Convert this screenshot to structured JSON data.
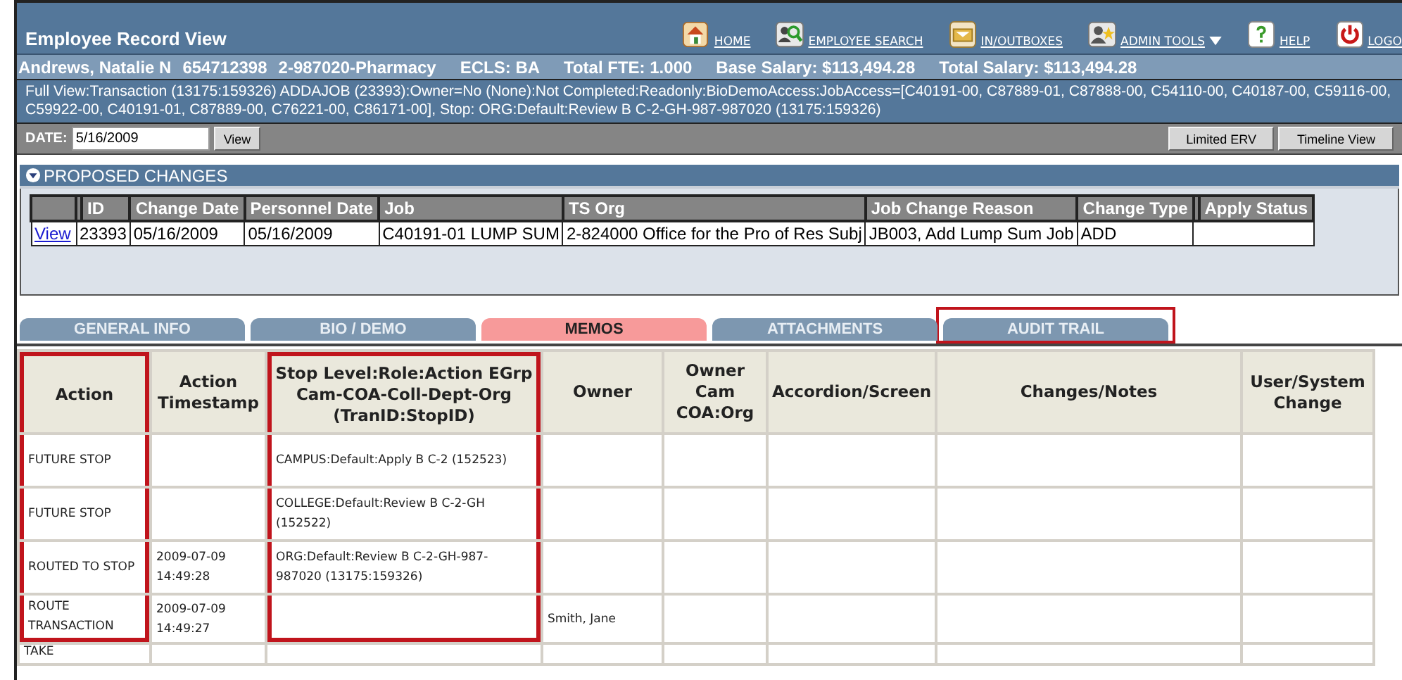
{
  "header": {
    "title": "Employee Record View",
    "nav": [
      {
        "label": "HOME",
        "dropdown": false
      },
      {
        "label": "EMPLOYEE SEARCH",
        "dropdown": false
      },
      {
        "label": "IN/OUTBOXES",
        "dropdown": false
      },
      {
        "label": "ADMIN TOOLS",
        "dropdown": true
      },
      {
        "label": "HELP",
        "dropdown": false
      },
      {
        "label": "LOGO",
        "dropdown": false
      }
    ]
  },
  "employee_bar": [
    "Andrews, Natalie N",
    "654712398",
    "2-987020-Pharmacy",
    "ECLS: BA",
    "Total FTE: 1.000",
    "Base Salary: $113,494.28",
    "Total Salary: $113,494.28"
  ],
  "full_view": "Full View:Transaction (13175:159326) ADDAJOB (23393):Owner=No (None):Not Completed:Readonly:BioDemoAccess:JobAccess=[C40191-00, C87889-01, C87888-00, C54110-00, C40187-00, C59116-00, C59922-00, C40191-01, C87889-00, C76221-00, C86171-00], Stop: ORG:Default:Review B C-2-GH-987-987020 (13175:159326)",
  "date_bar": {
    "label": "DATE:",
    "value": "5/16/2009",
    "view_button": "View",
    "buttons": [
      "Limited ERV",
      "Timeline View"
    ]
  },
  "proposed_changes": {
    "title": "PROPOSED CHANGES",
    "expanded": true,
    "columns": [
      "ID",
      "Change Date",
      "Personnel Date",
      "Job",
      "TS Org",
      "Job Change Reason",
      "Change Type",
      "Apply Status"
    ],
    "rows": [
      {
        "link": "View",
        "id": "23393",
        "change_date": "05/16/2009",
        "personnel_date": "05/16/2009",
        "job": "C40191-01 LUMP SUM",
        "ts_org": "2-824000 Office for the Pro of Res Subj",
        "reason": "JB003, Add Lump Sum Job",
        "change_type": "ADD"
      }
    ]
  },
  "tabs": [
    {
      "label": "GENERAL INFO",
      "selected": false,
      "highlighted": false
    },
    {
      "label": "BIO / DEMO",
      "selected": false,
      "highlighted": false
    },
    {
      "label": "MEMOS",
      "selected": true,
      "highlighted": false
    },
    {
      "label": "ATTACHMENTS",
      "selected": false,
      "highlighted": false
    },
    {
      "label": "AUDIT TRAIL",
      "selected": false,
      "highlighted": true
    }
  ],
  "audit_table": {
    "columns": [
      {
        "label": "Action",
        "highlighted": true
      },
      {
        "label": "Action Timestamp",
        "highlighted": false
      },
      {
        "label": "Stop Level:Role:Action EGrp Cam-COA-Coll-Dept-Org (TranID:StopID)",
        "highlighted": true
      },
      {
        "label": "Owner",
        "highlighted": false
      },
      {
        "label": "Owner Cam COA:Org",
        "highlighted": false
      },
      {
        "label": "Accordion/Screen",
        "highlighted": false
      },
      {
        "label": "Changes/Notes",
        "highlighted": false
      },
      {
        "label": "User/System Change",
        "highlighted": false
      }
    ],
    "rows": [
      {
        "partial": false,
        "cells": [
          "FUTURE STOP",
          "",
          "CAMPUS:Default:Apply B C-2 (152523)",
          "",
          "",
          "",
          "",
          ""
        ]
      },
      {
        "partial": false,
        "cells": [
          "FUTURE STOP",
          "",
          "COLLEGE:Default:Review B C-2-GH (152522)",
          "",
          "",
          "",
          "",
          ""
        ]
      },
      {
        "partial": false,
        "cells": [
          "ROUTED TO STOP",
          "2009-07-09 14:49:28",
          "ORG:Default:Review B C-2-GH-987-987020 (13175:159326)",
          "",
          "",
          "",
          "",
          ""
        ]
      },
      {
        "partial": false,
        "cells": [
          "ROUTE TRANSACTION",
          "2009-07-09 14:49:27",
          "",
          "Smith, Jane",
          "",
          "",
          "",
          ""
        ]
      },
      {
        "partial": true,
        "cells": [
          "TAKE",
          "",
          "",
          "",
          "",
          "",
          "",
          ""
        ]
      }
    ]
  }
}
